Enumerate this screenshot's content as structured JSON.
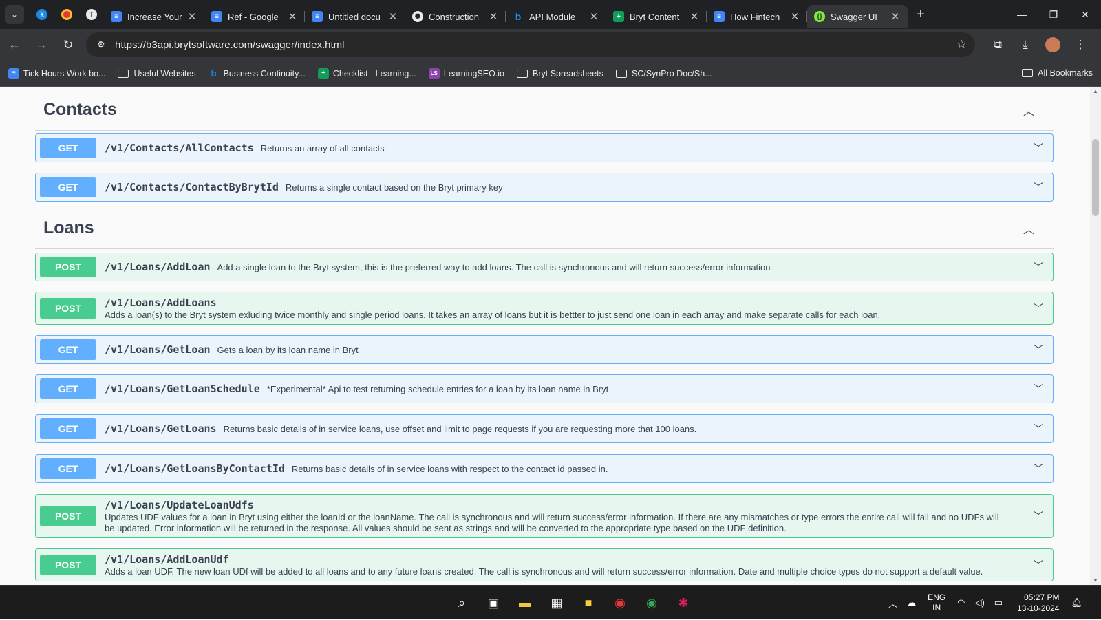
{
  "browser": {
    "tabs": [
      {
        "title": "Increase Your",
        "icon": "google-docs-icon",
        "color": "#4285f4"
      },
      {
        "title": "Ref - Google",
        "icon": "google-docs-icon",
        "color": "#4285f4"
      },
      {
        "title": "Untitled docu",
        "icon": "google-docs-icon",
        "color": "#4285f4"
      },
      {
        "title": "Construction",
        "icon": "chatgpt-icon",
        "color": "#e8eaed"
      },
      {
        "title": "API Module",
        "icon": "bryt-icon",
        "color": "#1e88e5"
      },
      {
        "title": "Bryt Content",
        "icon": "google-sheets-icon",
        "color": "#0f9d58"
      },
      {
        "title": "How Fintech",
        "icon": "google-docs-icon",
        "color": "#4285f4"
      },
      {
        "title": "Swagger UI",
        "icon": "swagger-icon",
        "color": "#85ea2d"
      }
    ],
    "url": "https://b3api.brytsoftware.com/swagger/index.html",
    "bookmarks": [
      {
        "label": "Tick Hours Work bo...",
        "icon": "google-docs-icon"
      },
      {
        "label": "Useful Websites",
        "icon": "folder-icon"
      },
      {
        "label": "Business Continuity...",
        "icon": "bryt-icon"
      },
      {
        "label": "Checklist - Learning...",
        "icon": "google-sheets-icon"
      },
      {
        "label": "LearningSEO.io",
        "icon": "ls-icon"
      },
      {
        "label": "Bryt Spreadsheets",
        "icon": "folder-icon"
      },
      {
        "label": "SC/SynPro Doc/Sh...",
        "icon": "folder-icon"
      }
    ],
    "all_bookmarks": "All Bookmarks"
  },
  "sections": {
    "contacts": {
      "name": "Contacts",
      "ops": [
        {
          "method": "GET",
          "path": "/v1/Contacts/AllContacts",
          "desc": "Returns an array of all contacts"
        },
        {
          "method": "GET",
          "path": "/v1/Contacts/ContactByBrytId",
          "desc": "Returns a single contact based on the Bryt primary key"
        }
      ]
    },
    "loans": {
      "name": "Loans",
      "ops": [
        {
          "method": "POST",
          "path": "/v1/Loans/AddLoan",
          "desc": "Add a single loan to the Bryt system, this is the preferred way to add loans. The call is synchronous and will return success/error information"
        },
        {
          "method": "POST",
          "path": "/v1/Loans/AddLoans",
          "desc": "Adds a loan(s) to the Bryt system exluding twice monthly and single period loans. It takes an array of loans but it is bettter to just send one loan in each array and make separate calls for each loan."
        },
        {
          "method": "GET",
          "path": "/v1/Loans/GetLoan",
          "desc": "Gets a loan by its loan name in Bryt"
        },
        {
          "method": "GET",
          "path": "/v1/Loans/GetLoanSchedule",
          "desc": "*Experimental* Api to test returning schedule entries for a loan by its loan name in Bryt"
        },
        {
          "method": "GET",
          "path": "/v1/Loans/GetLoans",
          "desc": "Returns basic details of in service loans, use offset and limit to page requests if you are requesting more that 100 loans."
        },
        {
          "method": "GET",
          "path": "/v1/Loans/GetLoansByContactId",
          "desc": "Returns basic details of in service loans with respect to the contact id passed in."
        },
        {
          "method": "POST",
          "path": "/v1/Loans/UpdateLoanUdfs",
          "desc": "Updates UDF values for a loan in Bryt using either the loanId or the loanName. The call is synchronous and will return success/error information. If there are any mismatches or type errors the entire call will fail and no UDFs will be updated. Error information will be returned in the response. All values should be sent as strings and will be converted to the appropriate type based on the UDF definition."
        },
        {
          "method": "POST",
          "path": "/v1/Loans/AddLoanUdf",
          "desc": "Adds a loan UDF. The new loan UDf will be added to all loans and to any future loans created. The call is synchronous and will return success/error information. Date and multiple choice types do not support a default value."
        }
      ]
    }
  },
  "taskbar": {
    "lang_top": "ENG",
    "lang_bottom": "IN",
    "time": "05:27 PM",
    "date": "13-10-2024"
  },
  "colors": {
    "get": "#61affe",
    "post": "#49cc90"
  }
}
